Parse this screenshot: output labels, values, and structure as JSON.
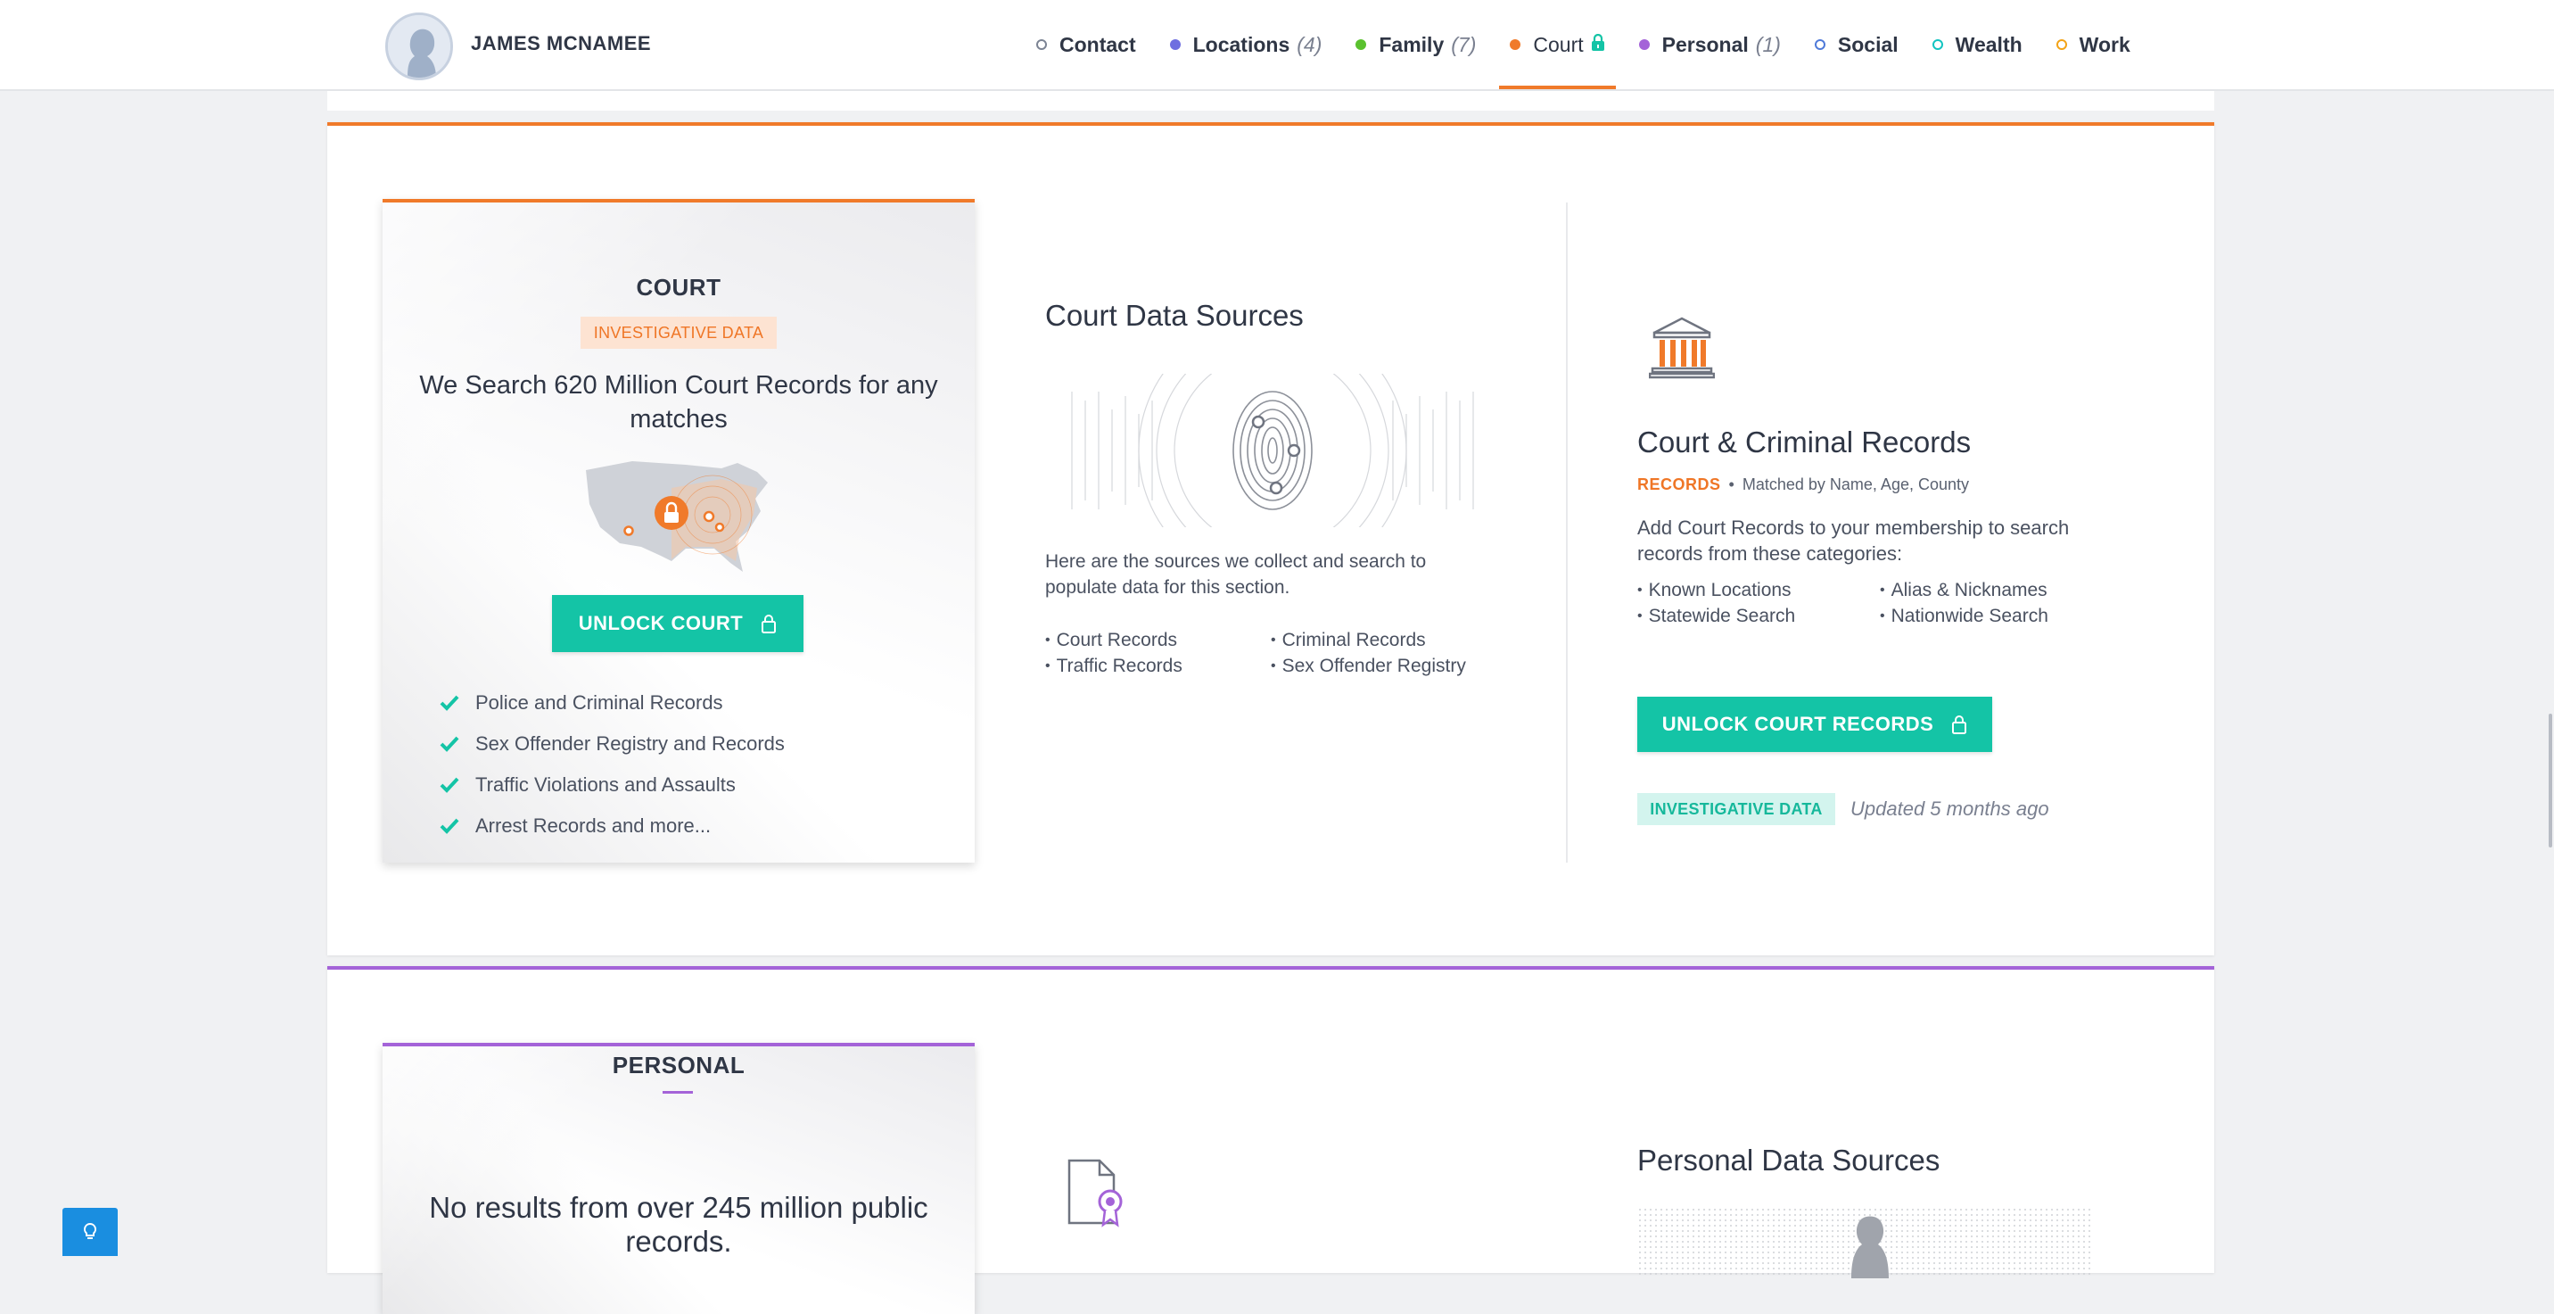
{
  "header": {
    "person_name": "JAMES MCNAMEE",
    "nav": [
      {
        "label": "Contact",
        "count": "",
        "dot_color": "#7c8494",
        "dot_style": "ring"
      },
      {
        "label": "Locations",
        "count": "(4)",
        "dot_color": "#6f6fe0",
        "dot_style": "filled"
      },
      {
        "label": "Family",
        "count": "(7)",
        "dot_color": "#5ac12e",
        "dot_style": "filled"
      },
      {
        "label": "Court",
        "count": "",
        "dot_color": "#f07a2a",
        "dot_style": "filled",
        "active": true,
        "locked": true
      },
      {
        "label": "Personal",
        "count": "(1)",
        "dot_color": "#a463d8",
        "dot_style": "filled"
      },
      {
        "label": "Social",
        "count": "",
        "dot_color": "#4f7ad9",
        "dot_style": "ring"
      },
      {
        "label": "Wealth",
        "count": "",
        "dot_color": "#12c4c1",
        "dot_style": "ring"
      },
      {
        "label": "Work",
        "count": "",
        "dot_color": "#f3a317",
        "dot_style": "ring"
      }
    ]
  },
  "court": {
    "promo": {
      "title": "COURT",
      "badge": "INVESTIGATIVE DATA",
      "headline": "We Search 620 Million Court Records for any matches",
      "button": "UNLOCK COURT",
      "features": [
        "Police and Criminal Records",
        "Sex Offender Registry and Records",
        "Traffic Violations and Assaults",
        "Arrest Records and more..."
      ]
    },
    "sources": {
      "title": "Court Data Sources",
      "description": "Here are the sources we collect and search to populate data for this section.",
      "items": [
        "Court Records",
        "Criminal Records",
        "Traffic Records",
        "Sex Offender Registry"
      ]
    },
    "records": {
      "title": "Court & Criminal Records",
      "tag": "RECORDS",
      "matched": "Matched by Name, Age, County",
      "description": "Add Court Records to your membership to search records from these categories:",
      "categories": [
        "Known Locations",
        "Alias & Nicknames",
        "Statewide Search",
        "Nationwide Search"
      ],
      "button": "UNLOCK COURT RECORDS",
      "badge": "INVESTIGATIVE DATA",
      "updated": "Updated 5 months ago"
    }
  },
  "personal": {
    "promo": {
      "title": "PERSONAL",
      "headline": "No results from over 245 million public records."
    },
    "sources_title": "Personal Data Sources"
  },
  "colors": {
    "court_accent": "#f07a2a",
    "personal_accent": "#a463d8",
    "teal": "#14c4a6",
    "help_button": "#1a8ee0"
  }
}
